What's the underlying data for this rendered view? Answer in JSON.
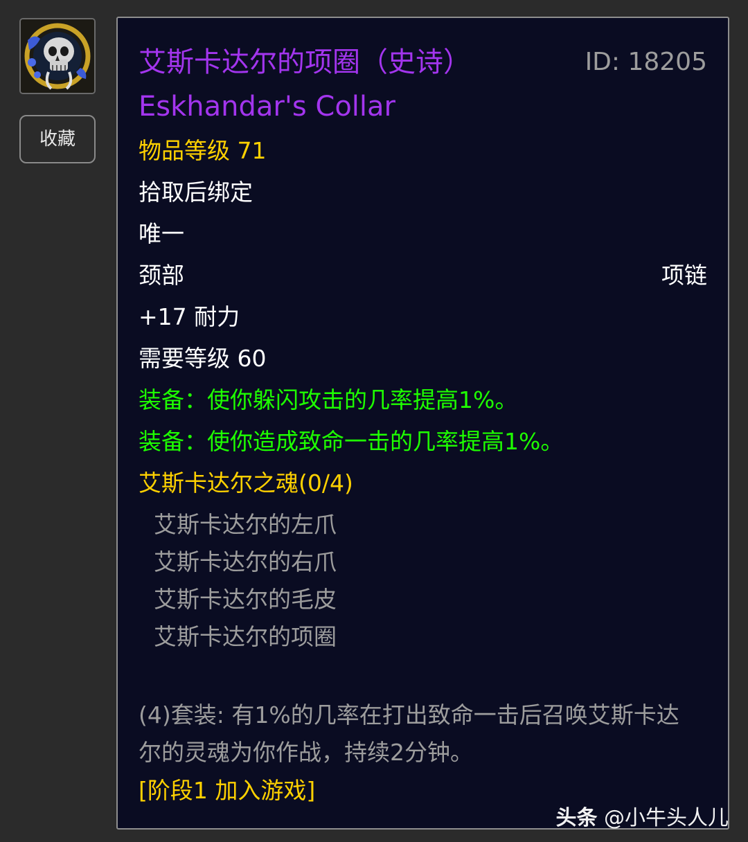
{
  "favorite_button": {
    "label": "收藏"
  },
  "item": {
    "name_cn": "艾斯卡达尔的项圈（史诗）",
    "id_text": "ID: 18205",
    "name_en": "Eskhandar's Collar",
    "item_level": "物品等级 71",
    "binding": "拾取后绑定",
    "uniqueness": "唯一",
    "slot": "颈部",
    "type": "项链",
    "stat": "+17 耐力",
    "required_level": "需要等级 60",
    "equip_effects": [
      "装备：使你躲闪攻击的几率提高1%。",
      "装备：使你造成致命一击的几率提高1%。"
    ],
    "set_name": "艾斯卡达尔之魂(0/4)",
    "set_items": [
      "艾斯卡达尔的左爪",
      "艾斯卡达尔的右爪",
      "艾斯卡达尔的毛皮",
      "艾斯卡达尔的项圈"
    ],
    "set_bonus": "(4)套装: 有1%的几率在打出致命一击后召唤艾斯卡达尔的灵魂为你作战，持续2分钟。",
    "phase": "[阶段1 加入游戏]"
  },
  "watermark": {
    "brand": "头条",
    "author": "@小牛头人儿"
  },
  "colors": {
    "epic": "#a335ee",
    "item_level": "#ffd100",
    "equip_effect": "#1eff00",
    "set_inactive": "#9d9d9d",
    "tooltip_bg": "#0a0c22",
    "page_bg": "#2b2b2b"
  },
  "icons": {
    "item": "skull-collar-icon"
  }
}
